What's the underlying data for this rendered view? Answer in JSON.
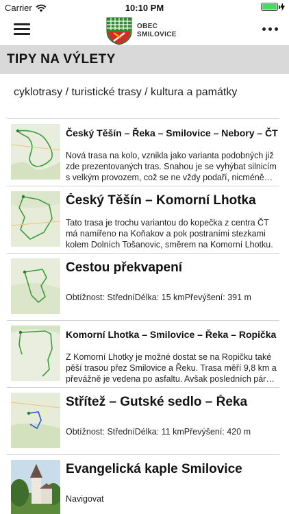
{
  "status_bar": {
    "carrier": "Carrier",
    "time": "10:10 PM",
    "battery_level": 1.0
  },
  "header": {
    "logo_line1": "OBEC",
    "logo_line2": "SMILOVICE",
    "menu_icon": "hamburger-menu-icon",
    "more_icon": "more-dots-icon"
  },
  "section": {
    "title": "TIPY NA VÝLETY",
    "categories": "cyklotrasy / turistické trasy / kultura a památky"
  },
  "items": [
    {
      "title": "Český Těšín – Řeka – Smilovice – Nebory – ČT",
      "description": "Nová trasa na kolo, vznikla jako varianta podobných již zde prezentovaných tras. Snahou je se vyhýbat silnicím s velkým provozem, což se ne vždy podaří, nicméně zbytek trasy je krásný."
    },
    {
      "title": "Český Těšín – Komorní Lhotka",
      "description": "Tato trasa je trochu variantou do kopečka z centra ČT má namířeno na Koňakov a pok postraními stezkami kolem Dolních Tošanovic, směrem na Komorní Lhotku."
    },
    {
      "title": "Cestou překvapení",
      "description": "Obtížnost: StředníDélka: 15 kmPřevýšení: 391 m"
    },
    {
      "title": "Komorní Lhotka – Smilovice – Řeka – Ropička",
      "description": "Z Komorní Lhotky je možné dostat se na Ropičku také pěší trasou přez Smilovice a Řeku. Trasa měří 9,8 km a převážně je vedena po asfaltu. Avšak posledních pár kilometrů je stoupání."
    },
    {
      "title": "Střítež – Gutské sedlo – Řeka",
      "description": "Obtížnost: StředníDélka: 11 kmPřevýšení: 420 m"
    },
    {
      "title": "Evangelická kaple Smilovice",
      "description": "Navigovat"
    }
  ]
}
